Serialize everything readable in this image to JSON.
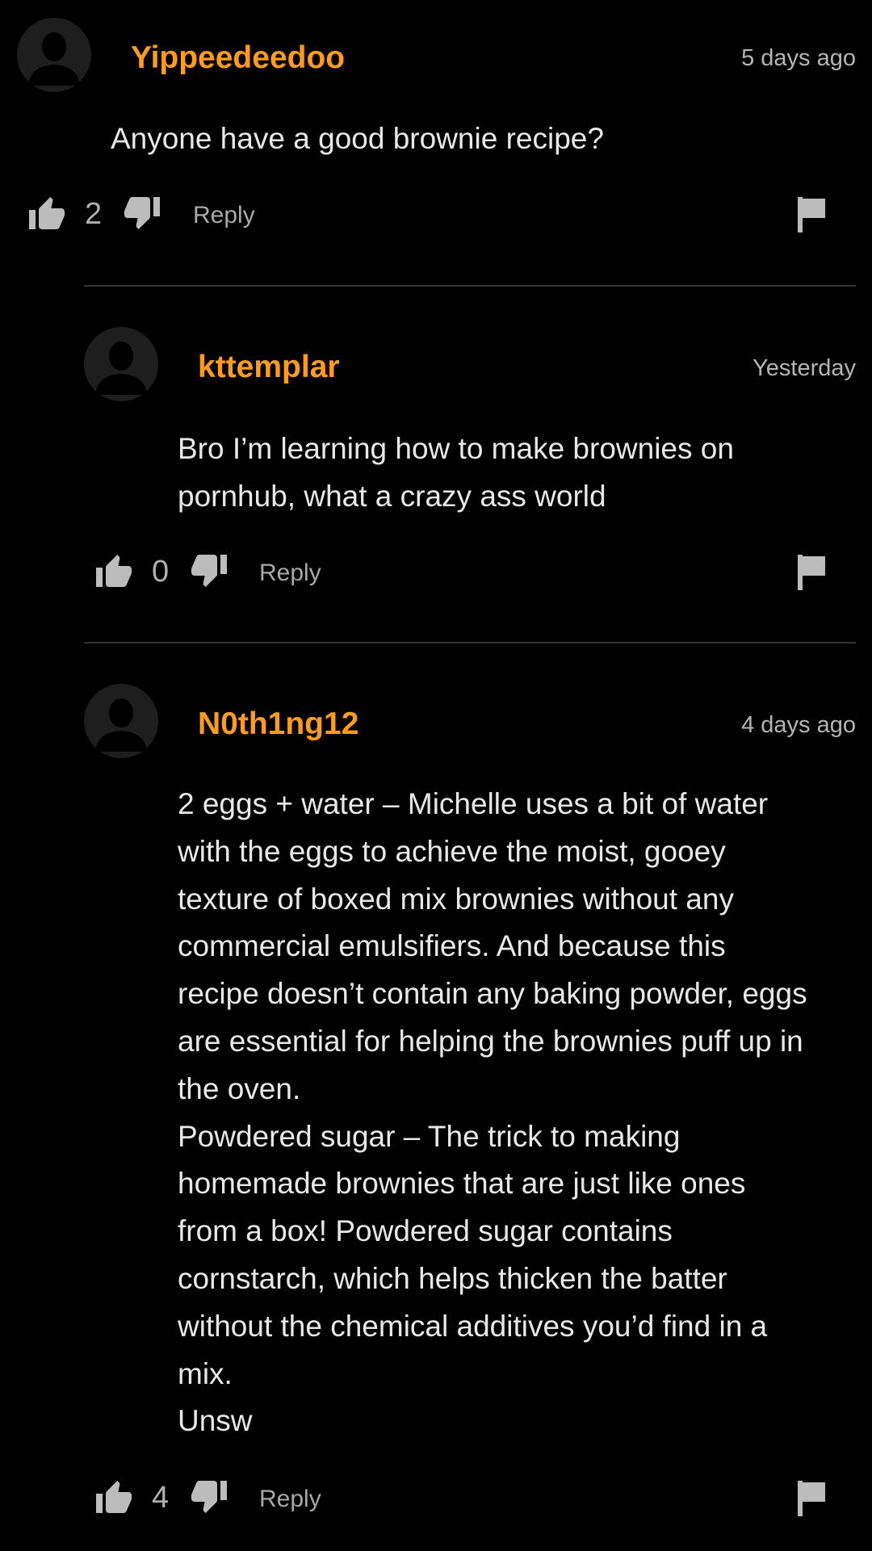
{
  "comments": [
    {
      "username": "Yippeedeedoo",
      "timestamp": "5 days ago",
      "text": "Anyone have a good brownie recipe?",
      "likes": "2",
      "reply_label": "Reply"
    },
    {
      "username": "kttemplar",
      "timestamp": "Yesterday",
      "text": "Bro I’m learning how to make brownies on\npornhub, what a crazy ass world",
      "likes": "0",
      "reply_label": "Reply"
    },
    {
      "username": "N0th1ng12",
      "timestamp": "4 days ago",
      "text": "2 eggs + water – Michelle uses a bit of water\nwith the eggs to achieve the moist, gooey\ntexture of boxed mix brownies without any\ncommercial emulsifiers. And because this\nrecipe doesn’t contain any baking powder, eggs\nare essential for helping the brownies puff up in\nthe oven.\nPowdered sugar – The trick to making\nhomemade brownies that are just like ones\nfrom a box! Powdered sugar contains\ncornstarch, which helps thicken the batter\nwithout the chemical additives you’d find in a\nmix.\nUnsw",
      "likes": "4",
      "reply_label": "Reply"
    }
  ],
  "icons": {
    "avatar": "avatar-silhouette-icon",
    "upvote": "thumbs-up-icon",
    "downvote": "thumbs-down-icon",
    "report": "flag-icon"
  },
  "colors": {
    "background": "#000000",
    "username": "#ff9c1a",
    "text": "#e8e8e8",
    "muted": "#a8a8a8",
    "divider": "#333333"
  }
}
